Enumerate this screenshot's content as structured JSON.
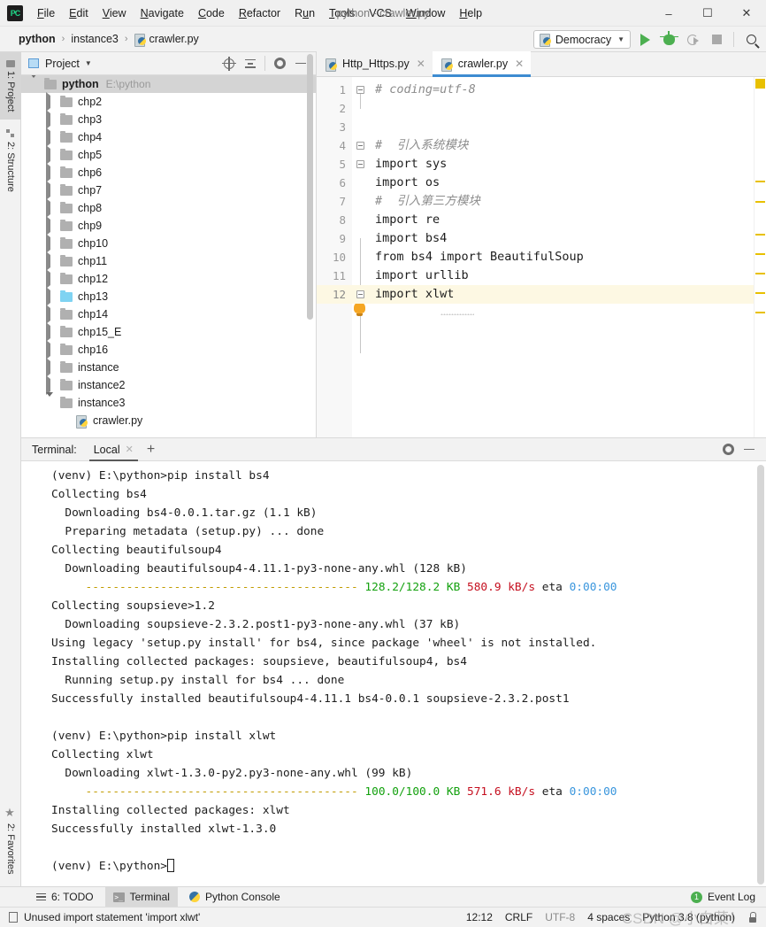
{
  "window": {
    "title": "python - crawler.py",
    "logo_text": "PC",
    "minimize": "–",
    "maximize": "☐",
    "close": "✕"
  },
  "menubar": {
    "items": [
      {
        "label": "File"
      },
      {
        "label": "Edit"
      },
      {
        "label": "View"
      },
      {
        "label": "Navigate"
      },
      {
        "label": "Code"
      },
      {
        "label": "Refactor"
      },
      {
        "label": "Run"
      },
      {
        "label": "Tools"
      },
      {
        "label": "VCS"
      },
      {
        "label": "Window"
      },
      {
        "label": "Help"
      }
    ]
  },
  "navbar": {
    "breadcrumb": [
      "python",
      "instance3",
      "crawler.py"
    ],
    "separator": "›",
    "run_config": "Democracy",
    "caret": "▼",
    "buttons": [
      "run-button",
      "debug-button",
      "run-with-coverage-button",
      "stop-button",
      "search-everywhere-button"
    ]
  },
  "left_strip": {
    "top_tabs": [
      {
        "label": "1: Project",
        "icon": "project-icon",
        "active": true
      },
      {
        "label": "2: Structure",
        "icon": "structure-icon",
        "active": false
      }
    ],
    "bottom_tabs": [
      {
        "label": "2: Favorites",
        "icon": "star-icon",
        "active": false
      }
    ]
  },
  "project_panel": {
    "title": "Project",
    "caret": "▼",
    "toolbar_icons": [
      "locate-icon",
      "collapse-all-icon",
      "settings-gear-icon",
      "hide-icon"
    ],
    "tree": [
      {
        "label": "python",
        "path": "E:\\python",
        "depth": 0,
        "state": "expanded",
        "kind": "root",
        "selected": true
      },
      {
        "label": "chp2",
        "depth": 1,
        "state": "collapsed",
        "kind": "folder"
      },
      {
        "label": "chp3",
        "depth": 1,
        "state": "collapsed",
        "kind": "folder"
      },
      {
        "label": "chp4",
        "depth": 1,
        "state": "collapsed",
        "kind": "folder"
      },
      {
        "label": "chp5",
        "depth": 1,
        "state": "collapsed",
        "kind": "folder"
      },
      {
        "label": "chp6",
        "depth": 1,
        "state": "collapsed",
        "kind": "folder"
      },
      {
        "label": "chp7",
        "depth": 1,
        "state": "collapsed",
        "kind": "folder"
      },
      {
        "label": "chp8",
        "depth": 1,
        "state": "collapsed",
        "kind": "folder"
      },
      {
        "label": "chp9",
        "depth": 1,
        "state": "collapsed",
        "kind": "folder"
      },
      {
        "label": "chp10",
        "depth": 1,
        "state": "collapsed",
        "kind": "folder"
      },
      {
        "label": "chp11",
        "depth": 1,
        "state": "collapsed",
        "kind": "folder"
      },
      {
        "label": "chp12",
        "depth": 1,
        "state": "collapsed",
        "kind": "folder"
      },
      {
        "label": "chp13",
        "depth": 1,
        "state": "collapsed",
        "kind": "folder-blue"
      },
      {
        "label": "chp14",
        "depth": 1,
        "state": "collapsed",
        "kind": "folder"
      },
      {
        "label": "chp15_E",
        "depth": 1,
        "state": "collapsed",
        "kind": "folder"
      },
      {
        "label": "chp16",
        "depth": 1,
        "state": "collapsed",
        "kind": "folder"
      },
      {
        "label": "instance",
        "depth": 1,
        "state": "collapsed",
        "kind": "folder"
      },
      {
        "label": "instance2",
        "depth": 1,
        "state": "collapsed",
        "kind": "folder"
      },
      {
        "label": "instance3",
        "depth": 1,
        "state": "expanded",
        "kind": "folder"
      },
      {
        "label": "crawler.py",
        "depth": 2,
        "state": "none",
        "kind": "pyfile"
      }
    ]
  },
  "editor": {
    "tabs": [
      {
        "label": "Http_Https.py",
        "active": false,
        "close": "✕"
      },
      {
        "label": "crawler.py",
        "active": true,
        "close": "✕"
      }
    ],
    "current_line": 12,
    "lines": [
      {
        "n": 1,
        "text": "# coding=utf-8",
        "style": "comment",
        "fold": "open"
      },
      {
        "n": 2,
        "text": "",
        "style": "plain",
        "fold": "none"
      },
      {
        "n": 3,
        "text": "",
        "style": "plain",
        "fold": "none"
      },
      {
        "n": 4,
        "text": "#  引入系统模块",
        "style": "comment",
        "fold": "open"
      },
      {
        "n": 5,
        "text": "import sys",
        "style": "plain",
        "fold": "open"
      },
      {
        "n": 6,
        "text": "import os",
        "style": "plain",
        "fold": "none"
      },
      {
        "n": 7,
        "text": "#  引入第三方模块",
        "style": "comment",
        "fold": "none"
      },
      {
        "n": 8,
        "text": "import re",
        "style": "plain",
        "fold": "none"
      },
      {
        "n": 9,
        "text": "import bs4",
        "style": "plain",
        "fold": "none"
      },
      {
        "n": 10,
        "text": "from bs4 import BeautifulSoup",
        "style": "plain",
        "fold": "none"
      },
      {
        "n": 11,
        "text": "import urllib",
        "style": "plain",
        "fold": "none"
      },
      {
        "n": 12,
        "text": "import xlwt",
        "style": "plain",
        "fold": "open"
      }
    ],
    "quickfix_icon": "lightbulb-icon"
  },
  "terminal": {
    "label": "Terminal:",
    "tab": "Local",
    "tab_close": "✕",
    "add": "+",
    "toolbar_icons": [
      "settings-gear-icon",
      "hide-icon"
    ],
    "lines": [
      [
        {
          "t": "(venv) E:\\python>pip install bs4",
          "c": "plain"
        }
      ],
      [
        {
          "t": "Collecting bs4",
          "c": "plain"
        }
      ],
      [
        {
          "t": "  Downloading bs4-0.0.1.tar.gz (1.1 kB)",
          "c": "plain"
        }
      ],
      [
        {
          "t": "  Preparing metadata (setup.py) ... done",
          "c": "plain"
        }
      ],
      [
        {
          "t": "Collecting beautifulsoup4",
          "c": "plain"
        }
      ],
      [
        {
          "t": "  Downloading beautifulsoup4-4.11.1-py3-none-any.whl (128 kB)",
          "c": "plain"
        }
      ],
      [
        {
          "t": "     ---------------------------------------- ",
          "c": "yellow"
        },
        {
          "t": "128.2/128.2 KB",
          "c": "green"
        },
        {
          "t": " ",
          "c": "plain"
        },
        {
          "t": "580.9 kB/s",
          "c": "red"
        },
        {
          "t": " eta ",
          "c": "plain"
        },
        {
          "t": "0:00:00",
          "c": "cyan"
        }
      ],
      [
        {
          "t": "Collecting soupsieve>1.2",
          "c": "plain"
        }
      ],
      [
        {
          "t": "  Downloading soupsieve-2.3.2.post1-py3-none-any.whl (37 kB)",
          "c": "plain"
        }
      ],
      [
        {
          "t": "Using legacy 'setup.py install' for bs4, since package 'wheel' is not installed.",
          "c": "plain"
        }
      ],
      [
        {
          "t": "Installing collected packages: soupsieve, beautifulsoup4, bs4",
          "c": "plain"
        }
      ],
      [
        {
          "t": "  Running setup.py install for bs4 ... done",
          "c": "plain"
        }
      ],
      [
        {
          "t": "Successfully installed beautifulsoup4-4.11.1 bs4-0.0.1 soupsieve-2.3.2.post1",
          "c": "plain"
        }
      ],
      [
        {
          "t": "",
          "c": "plain"
        }
      ],
      [
        {
          "t": "(venv) E:\\python>pip install xlwt",
          "c": "plain"
        }
      ],
      [
        {
          "t": "Collecting xlwt",
          "c": "plain"
        }
      ],
      [
        {
          "t": "  Downloading xlwt-1.3.0-py2.py3-none-any.whl (99 kB)",
          "c": "plain"
        }
      ],
      [
        {
          "t": "     ---------------------------------------- ",
          "c": "yellow"
        },
        {
          "t": "100.0/100.0 KB",
          "c": "green"
        },
        {
          "t": " ",
          "c": "plain"
        },
        {
          "t": "571.6 kB/s",
          "c": "red"
        },
        {
          "t": " eta ",
          "c": "plain"
        },
        {
          "t": "0:00:00",
          "c": "cyan"
        }
      ],
      [
        {
          "t": "Installing collected packages: xlwt",
          "c": "plain"
        }
      ],
      [
        {
          "t": "Successfully installed xlwt-1.3.0",
          "c": "plain"
        }
      ],
      [
        {
          "t": "",
          "c": "plain"
        }
      ],
      [
        {
          "t": "(venv) E:\\python>",
          "c": "plain",
          "cursor": true
        }
      ]
    ]
  },
  "toolwindow_bar": {
    "tabs": [
      {
        "label": "6: TODO",
        "icon": "todo-icon",
        "active": false
      },
      {
        "label": "Terminal",
        "icon": "terminal-icon",
        "active": true
      },
      {
        "label": "Python Console",
        "icon": "python-icon",
        "active": false
      }
    ],
    "event_log": {
      "label": "Event Log",
      "count": "1"
    }
  },
  "statusbar": {
    "message": "Unused import statement 'import xlwt'",
    "caret_position": "12:12",
    "line_separator": "CRLF",
    "encoding": "UTF-8",
    "indent": "4 spaces",
    "interpreter": "Python 3.8 (python)",
    "lock_icon": "lock-icon",
    "watermark": "CSDN @小白菜！"
  },
  "colors": {
    "accent_blue": "#3d8bd1",
    "run_green": "#4caf50",
    "marker_yellow": "#e8c000",
    "current_line": "#fdf8e3",
    "selection_gray": "#d4d4d4"
  }
}
